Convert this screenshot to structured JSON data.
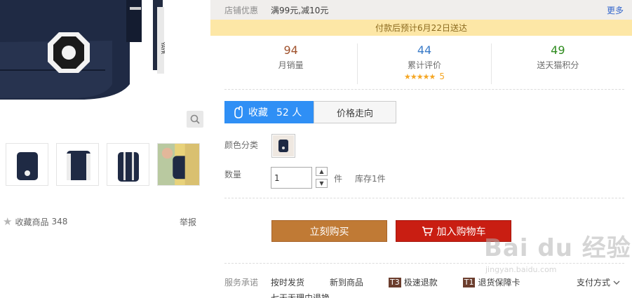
{
  "left": {
    "fav_label": "收藏商品",
    "fav_count": "348",
    "report_label": "举报"
  },
  "promo": {
    "label": "店铺优惠",
    "value": "满99元,减10元",
    "more": "更多"
  },
  "delivery": "付款后预计6月22日送达",
  "stats": {
    "monthly_sales": {
      "value": "94",
      "label": "月销量",
      "color": "#a0522d"
    },
    "reviews": {
      "value": "44",
      "label": "累计评价",
      "stars": "★★★★★",
      "score": "5",
      "color": "#3a7bc8"
    },
    "points": {
      "value": "49",
      "label": "送天猫积分",
      "color": "#2e8b1e"
    }
  },
  "favorite": {
    "label": "收藏",
    "count": "52 人"
  },
  "price_trend": "价格走向",
  "color_label": "颜色分类",
  "quantity": {
    "label": "数量",
    "value": "1",
    "unit": "件",
    "stock": "库存1件"
  },
  "buttons": {
    "buy_now": "立刻购买",
    "add_cart": "加入购物车"
  },
  "service": {
    "label": "服务承诺",
    "items": [
      {
        "tag": "",
        "text": "按时发货"
      },
      {
        "tag": "",
        "text": "新到商品"
      },
      {
        "tag": "T3",
        "text": "极速退款"
      },
      {
        "tag": "T1",
        "text": "退货保障卡"
      }
    ],
    "pay_label": "支付方式",
    "extra": "七天无理由退换"
  },
  "watermark": {
    "title": "Bai du 经验",
    "url": "jingyan.baidu.com"
  }
}
